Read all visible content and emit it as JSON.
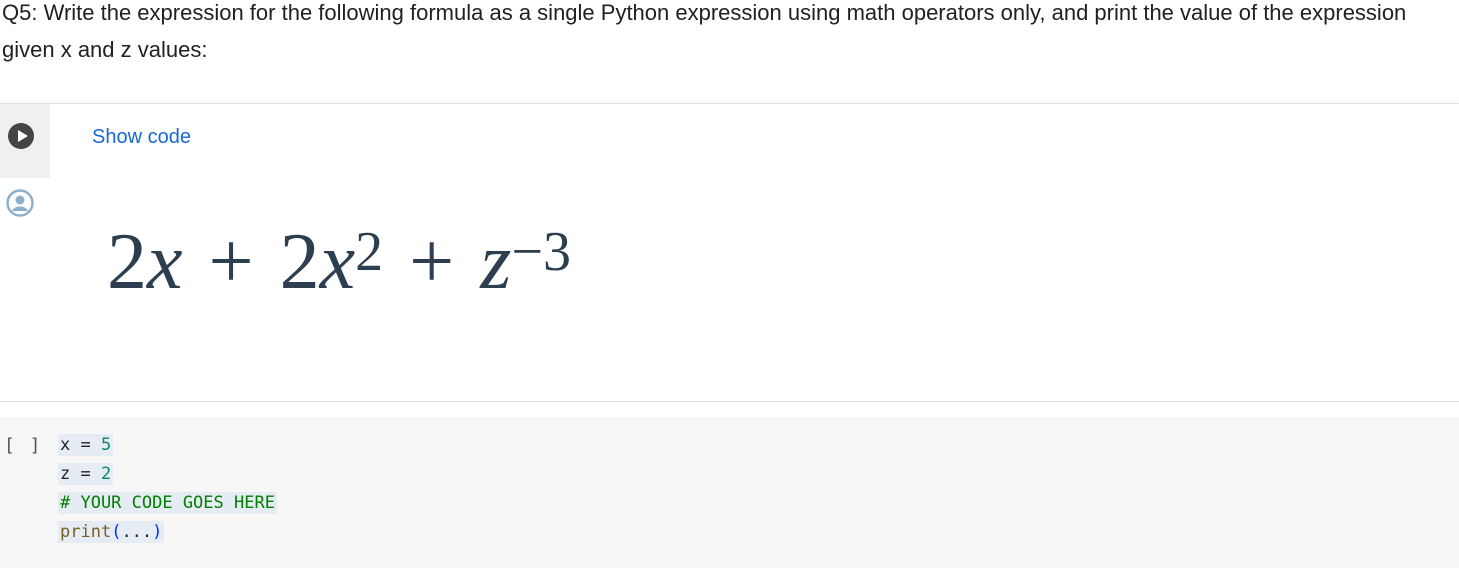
{
  "question": {
    "text": "Q5: Write the expression for the following formula as a single Python expression using math operators only, and print the value of the expression given x and z values:"
  },
  "text_cell": {
    "run_icon": "play-circle-icon",
    "avatar_icon": "user-avatar-icon",
    "show_code_label": "Show code",
    "formula": {
      "term1_coef": "2",
      "term1_var": "x",
      "op1": "+",
      "term2_coef": "2",
      "term2_var": "x",
      "term2_exp": "2",
      "op2": "+",
      "term3_var": "z",
      "term3_exp": "−3"
    }
  },
  "code_cell": {
    "bracket": "[ ]",
    "lines": {
      "l1": {
        "var": "x",
        "op": "=",
        "val": "5"
      },
      "l2": {
        "var": "z",
        "op": "=",
        "val": "2"
      },
      "l3": {
        "comment": "# YOUR CODE GOES HERE"
      },
      "l4": {
        "fn": "print",
        "open": "(",
        "args": "...",
        "close": ")"
      }
    }
  },
  "colors": {
    "link": "#1967d2",
    "formula": "#2c3e50",
    "comment": "#008000",
    "number": "#09885a",
    "function": "#795e26"
  }
}
